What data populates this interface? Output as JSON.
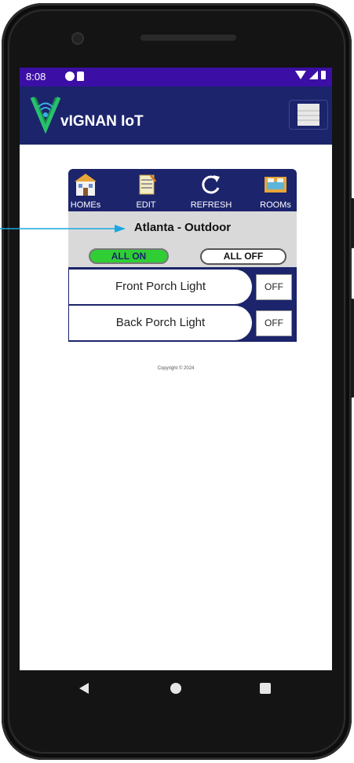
{
  "status_bar": {
    "time": "8:08"
  },
  "app_bar": {
    "title": "vIGNAN IoT"
  },
  "toolbar": [
    {
      "label": "HOMEs",
      "icon": "house-icon"
    },
    {
      "label": "EDIT",
      "icon": "notepad-edit-icon"
    },
    {
      "label": "REFRESH",
      "icon": "refresh-icon"
    },
    {
      "label": "ROOMs",
      "icon": "rooms-icon"
    }
  ],
  "room": {
    "title": "Atlanta - Outdoor",
    "all_on_label": "ALL ON",
    "all_off_label": "ALL OFF"
  },
  "devices": [
    {
      "name": "Front Porch Light",
      "state": "OFF"
    },
    {
      "name": "Back Porch Light",
      "state": "OFF"
    }
  ],
  "footer": {
    "copyright": "Copyright © 2024"
  },
  "colors": {
    "status_bar": "#3b0fa5",
    "app_bar": "#1c246c",
    "all_on": "#2fce35",
    "pointer": "#1aa7e0"
  }
}
